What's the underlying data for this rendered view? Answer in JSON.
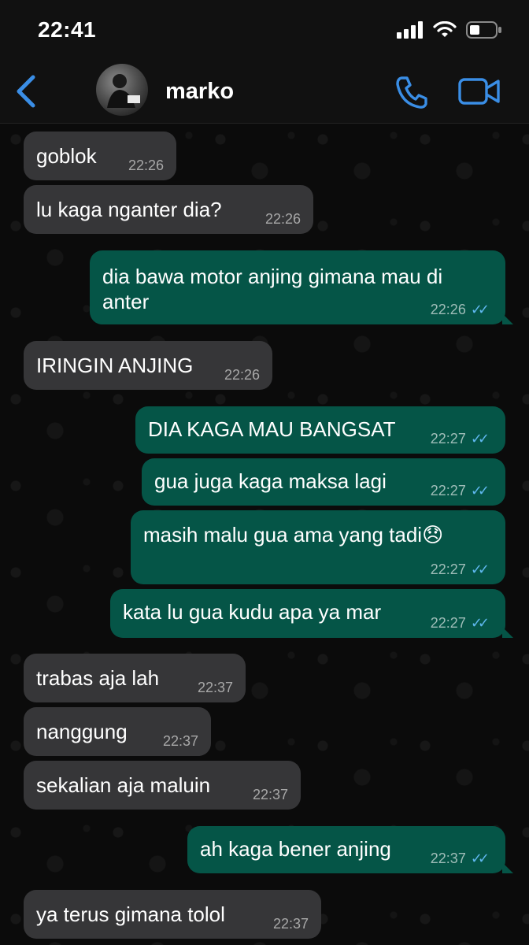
{
  "status_bar": {
    "time": "22:41"
  },
  "header": {
    "back_label": "<",
    "contact_name": "marko"
  },
  "messages": [
    {
      "dir": "in",
      "text": "goblok",
      "time": "22:26"
    },
    {
      "dir": "in",
      "text": "lu kaga nganter dia?",
      "time": "22:26"
    },
    {
      "dir": "out",
      "line1": "dia bawa motor anjing gimana mau di",
      "line2": "anter",
      "time": "22:26"
    },
    {
      "dir": "in",
      "text": "IRINGIN ANJING",
      "time": "22:26"
    },
    {
      "dir": "out",
      "text": "DIA KAGA MAU BANGSAT",
      "time": "22:27"
    },
    {
      "dir": "out",
      "text": "gua juga kaga maksa lagi",
      "time": "22:27"
    },
    {
      "dir": "out",
      "text": "masih malu gua ama yang tadi😞",
      "time": "22:27"
    },
    {
      "dir": "out",
      "text": "kata lu gua kudu apa ya mar",
      "time": "22:27"
    },
    {
      "dir": "in",
      "text": "trabas aja lah",
      "time": "22:37"
    },
    {
      "dir": "in",
      "text": "nanggung",
      "time": "22:37"
    },
    {
      "dir": "in",
      "text": "sekalian aja maluin",
      "time": "22:37"
    },
    {
      "dir": "out",
      "text": "ah kaga bener anjing",
      "time": "22:37"
    },
    {
      "dir": "in",
      "text": "ya terus gimana tolol",
      "time": "22:37"
    }
  ],
  "icons": {
    "signal": "signal-icon",
    "wifi": "wifi-icon",
    "battery": "battery-icon",
    "back": "chevron-left-icon",
    "call": "phone-icon",
    "video": "video-call-icon",
    "read": "double-check-icon"
  },
  "colors": {
    "accent": "#3a8ee6",
    "incoming_bubble": "#363638",
    "outgoing_bubble": "#055547",
    "read_tick": "#5fb7ee"
  }
}
